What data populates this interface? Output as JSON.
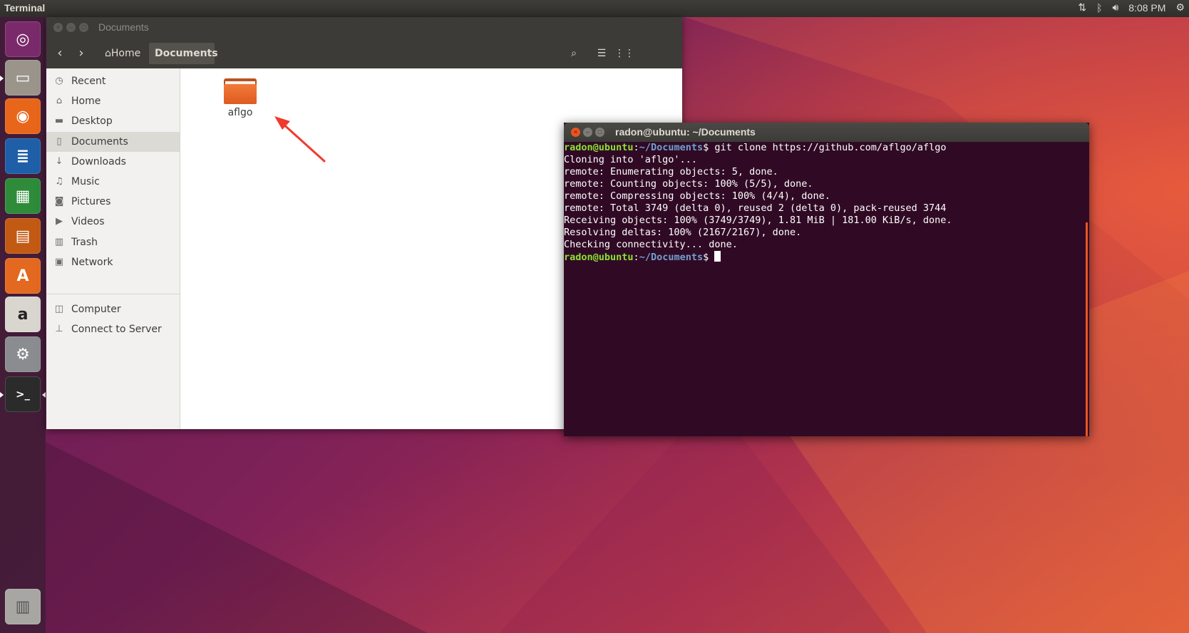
{
  "top_panel": {
    "app_title": "Terminal",
    "clock": "8:08 PM",
    "tray_icons": [
      "network-arrows-icon",
      "bluetooth-icon",
      "volume-icon",
      "power-gear-icon"
    ]
  },
  "launcher": {
    "items": [
      {
        "name": "ubuntu-dash-icon",
        "color": "#7a2a6a",
        "glyph": "◎"
      },
      {
        "name": "files-icon",
        "color": "#9a948b",
        "glyph": "▭"
      },
      {
        "name": "firefox-icon",
        "color": "#e8661a",
        "glyph": "◉"
      },
      {
        "name": "writer-icon",
        "color": "#1f5fa8",
        "glyph": "≣"
      },
      {
        "name": "calc-icon",
        "color": "#2e8b3a",
        "glyph": "▦"
      },
      {
        "name": "impress-icon",
        "color": "#c25a14",
        "glyph": "▤"
      },
      {
        "name": "software-center-icon",
        "color": "#e2691f",
        "glyph": "A"
      },
      {
        "name": "amazon-icon",
        "color": "#d9d6d0",
        "glyph": "a"
      },
      {
        "name": "system-settings-icon",
        "color": "#8a8c90",
        "glyph": "⚙"
      },
      {
        "name": "terminal-icon",
        "color": "#2b2b2b",
        "glyph": ">_"
      }
    ],
    "trash": {
      "name": "trash-icon",
      "color": "#a8a6a2"
    }
  },
  "files": {
    "title": "Documents",
    "breadcrumb": {
      "home": "Home",
      "current": "Documents"
    },
    "sidebar": [
      {
        "label": "Recent",
        "icon": "◷",
        "icon_name": "clock-icon"
      },
      {
        "label": "Home",
        "icon": "⌂",
        "icon_name": "home-icon"
      },
      {
        "label": "Desktop",
        "icon": "▬",
        "icon_name": "desktop-folder-icon"
      },
      {
        "label": "Documents",
        "icon": "▯",
        "icon_name": "document-icon"
      },
      {
        "label": "Downloads",
        "icon": "↓",
        "icon_name": "download-icon"
      },
      {
        "label": "Music",
        "icon": "♫",
        "icon_name": "music-icon"
      },
      {
        "label": "Pictures",
        "icon": "◙",
        "icon_name": "camera-icon"
      },
      {
        "label": "Videos",
        "icon": "▶",
        "icon_name": "video-icon"
      },
      {
        "label": "Trash",
        "icon": "▥",
        "icon_name": "trash-bin-icon"
      },
      {
        "label": "Network",
        "icon": "▣",
        "icon_name": "network-icon"
      }
    ],
    "sidebar_bottom": [
      {
        "label": "Computer",
        "icon": "◫",
        "icon_name": "computer-icon"
      },
      {
        "label": "Connect to Server",
        "icon": "⊥",
        "icon_name": "server-icon"
      }
    ],
    "selected_sidebar": "Documents",
    "folder": {
      "label": "aflgo"
    }
  },
  "terminal": {
    "title": "radon@ubuntu: ~/Documents",
    "prompt_user": "radon@ubuntu",
    "prompt_path": "~/Documents",
    "command": "git clone https://github.com/aflgo/aflgo",
    "output": [
      "Cloning into 'aflgo'...",
      "remote: Enumerating objects: 5, done.",
      "remote: Counting objects: 100% (5/5), done.",
      "remote: Compressing objects: 100% (4/4), done.",
      "remote: Total 3749 (delta 0), reused 2 (delta 0), pack-reused 3744",
      "Receiving objects: 100% (3749/3749), 1.81 MiB | 181.00 KiB/s, done.",
      "Resolving deltas: 100% (2167/2167), done.",
      "Checking connectivity... done."
    ]
  },
  "colors": {
    "accent": "#e95420",
    "terminal_bg": "#300a24",
    "prompt_user": "#8ae234",
    "prompt_path": "#729fcf",
    "annotation_arrow": "#f03a2e"
  }
}
